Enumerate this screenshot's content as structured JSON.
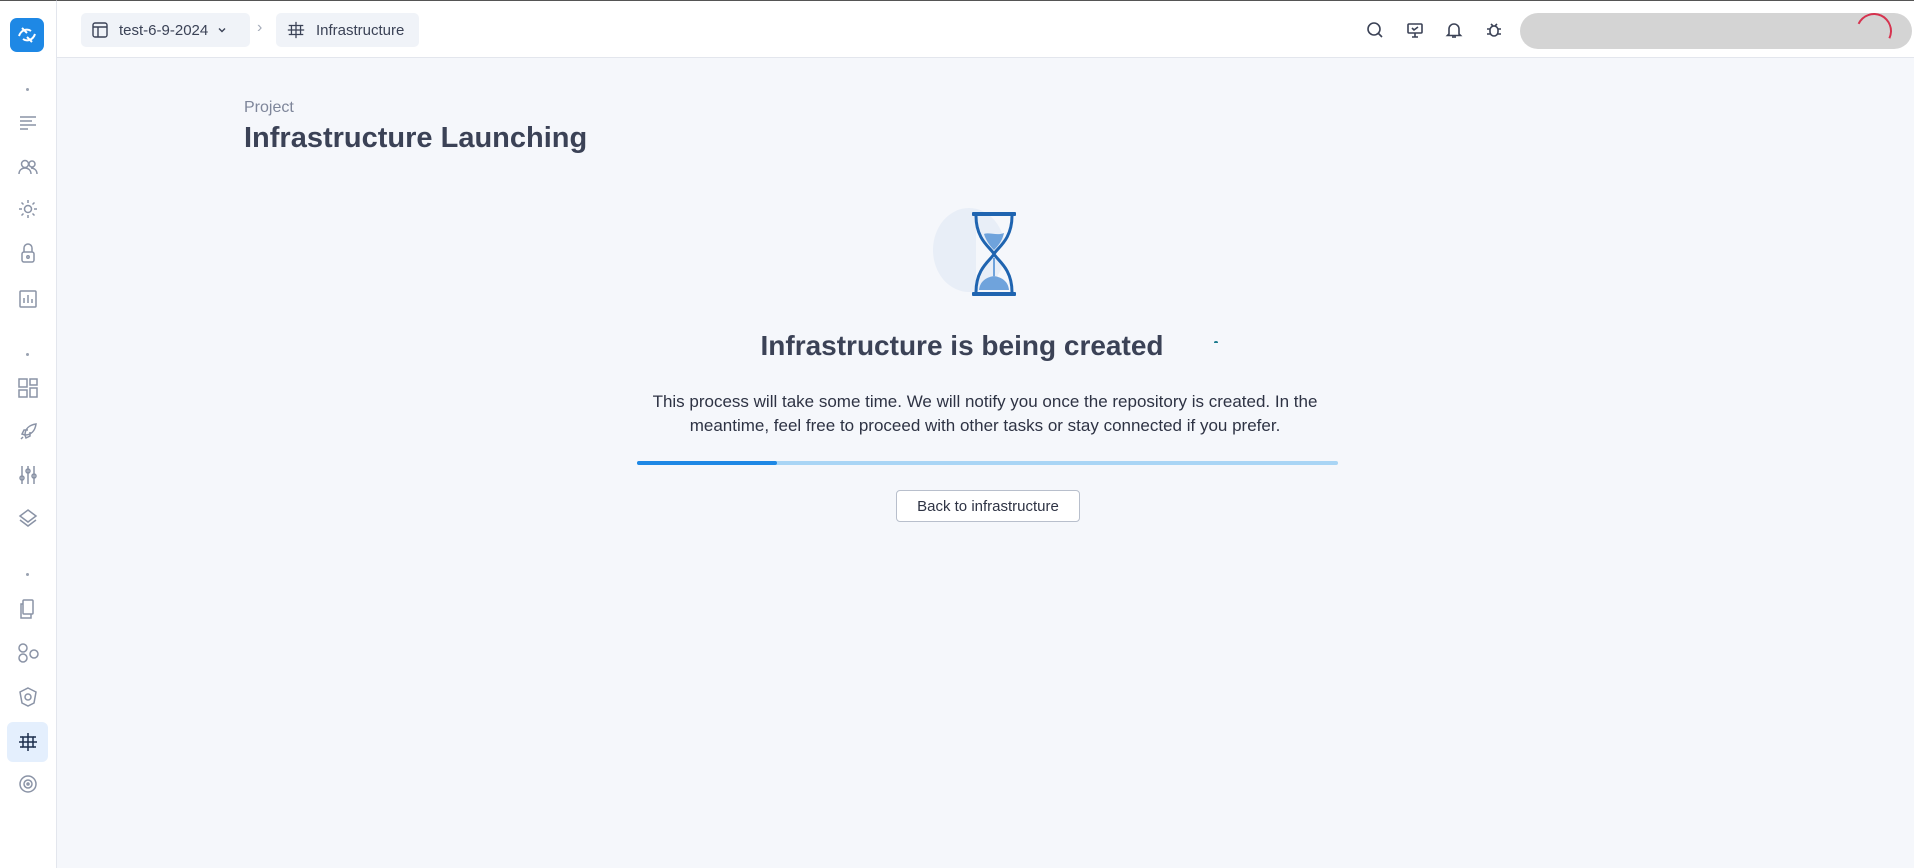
{
  "icons": {
    "logo": "app-logo-icon",
    "sidebar": [
      "list-icon",
      "users-icon",
      "gear-icon",
      "lock-icon",
      "chart-icon",
      "dashboard-icon",
      "rocket-icon",
      "sliders-icon",
      "layers-icon",
      "documents-icon",
      "shapes-icon",
      "security-icon",
      "infrastructure-icon",
      "target-icon"
    ],
    "topbar": [
      "search-icon",
      "monitor-icon",
      "bell-icon",
      "bug-icon"
    ]
  },
  "breadcrumb": {
    "project": "test-6-9-2024",
    "section": "Infrastructure"
  },
  "page": {
    "label": "Project",
    "title": "Infrastructure Launching"
  },
  "status": {
    "title": "Infrastructure is being created",
    "description": "This process will take some time. We will notify you once the repository is created. In the meantime, feel free to proceed with other tasks or stay connected if you prefer.",
    "progress_percent": 20
  },
  "actions": {
    "back_label": "Back to infrastructure"
  },
  "colors": {
    "accent": "#1e88e5",
    "progress_track": "#a9d5f5",
    "active_nav_bg": "#e4effd"
  }
}
